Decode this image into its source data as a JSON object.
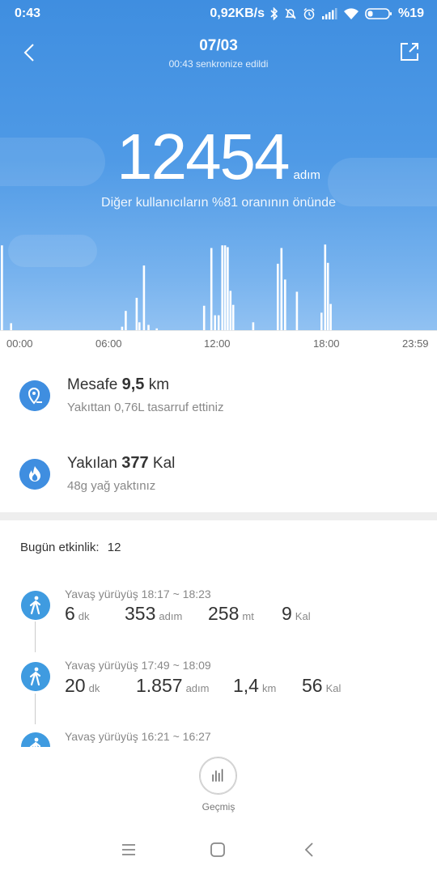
{
  "status_bar": {
    "time": "0:43",
    "net_speed": "0,92KB/s",
    "battery": "%19",
    "icons": [
      "bluetooth-icon",
      "mute-icon",
      "alarm-icon",
      "signal-icon",
      "wifi-icon",
      "battery-icon"
    ]
  },
  "header": {
    "date": "07/03",
    "sync_text": "00:43 senkronize edildi",
    "back_icon": "chevron-left-icon",
    "share_icon": "share-icon"
  },
  "summary": {
    "steps": "12454",
    "steps_unit": "adım",
    "rank_text": "Diğer kullanıcıların %81 oranının önünde"
  },
  "chart_data": {
    "type": "bar",
    "title": "",
    "x_tick_labels": [
      "00:00",
      "06:00",
      "12:00",
      "18:00",
      "23:59"
    ],
    "x_range_hours": [
      0,
      24
    ],
    "bars": [
      {
        "x": 0.05,
        "v": 0.97
      },
      {
        "x": 0.55,
        "v": 0.08
      },
      {
        "x": 6.65,
        "v": 0.04
      },
      {
        "x": 6.85,
        "v": 0.22
      },
      {
        "x": 7.45,
        "v": 0.37
      },
      {
        "x": 7.6,
        "v": 0.09
      },
      {
        "x": 7.85,
        "v": 0.74
      },
      {
        "x": 8.1,
        "v": 0.06
      },
      {
        "x": 8.55,
        "v": 0.02
      },
      {
        "x": 11.15,
        "v": 0.28
      },
      {
        "x": 11.55,
        "v": 0.94
      },
      {
        "x": 11.75,
        "v": 0.17
      },
      {
        "x": 11.95,
        "v": 0.17
      },
      {
        "x": 12.15,
        "v": 0.97
      },
      {
        "x": 12.3,
        "v": 0.97
      },
      {
        "x": 12.45,
        "v": 0.95
      },
      {
        "x": 12.6,
        "v": 0.45
      },
      {
        "x": 12.75,
        "v": 0.29
      },
      {
        "x": 13.85,
        "v": 0.09
      },
      {
        "x": 15.2,
        "v": 0.76
      },
      {
        "x": 15.4,
        "v": 0.94
      },
      {
        "x": 15.6,
        "v": 0.58
      },
      {
        "x": 16.25,
        "v": 0.44
      },
      {
        "x": 17.6,
        "v": 0.2
      },
      {
        "x": 17.8,
        "v": 0.98
      },
      {
        "x": 17.95,
        "v": 0.77
      },
      {
        "x": 18.1,
        "v": 0.3
      }
    ],
    "ylim": [
      0,
      1
    ],
    "grid": false,
    "bar_color": "#ffffff"
  },
  "distance": {
    "label": "Mesafe",
    "value": "9,5",
    "unit": "km",
    "sub": "Yakıttan 0,76L tasarruf ettiniz",
    "icon": "location-pin-icon"
  },
  "calories": {
    "label": "Yakılan",
    "value": "377",
    "unit": "Kal",
    "sub": "48g yağ yaktınız",
    "icon": "flame-icon"
  },
  "activities": {
    "count_label": "Bugün etkinlik:",
    "count": "12",
    "items": [
      {
        "title": "Yavaş yürüyüş 18:17 ~ 18:23",
        "duration": "6",
        "duration_unit": "dk",
        "steps": "353",
        "steps_unit": "adım",
        "distance": "258",
        "distance_unit": "mt",
        "cal": "9",
        "cal_unit": "Kal"
      },
      {
        "title": "Yavaş yürüyüş 17:49 ~ 18:09",
        "duration": "20",
        "duration_unit": "dk",
        "steps": "1.857",
        "steps_unit": "adım",
        "distance": "1,4",
        "distance_unit": "km",
        "cal": "56",
        "cal_unit": "Kal"
      },
      {
        "title": "Yavaş yürüyüş 16:21 ~ 16:27"
      }
    ]
  },
  "history": {
    "label": "Geçmiş",
    "icon": "bar-chart-icon"
  },
  "colors": {
    "accent": "#3f8ee0",
    "activity_icon": "#3f9be0"
  }
}
